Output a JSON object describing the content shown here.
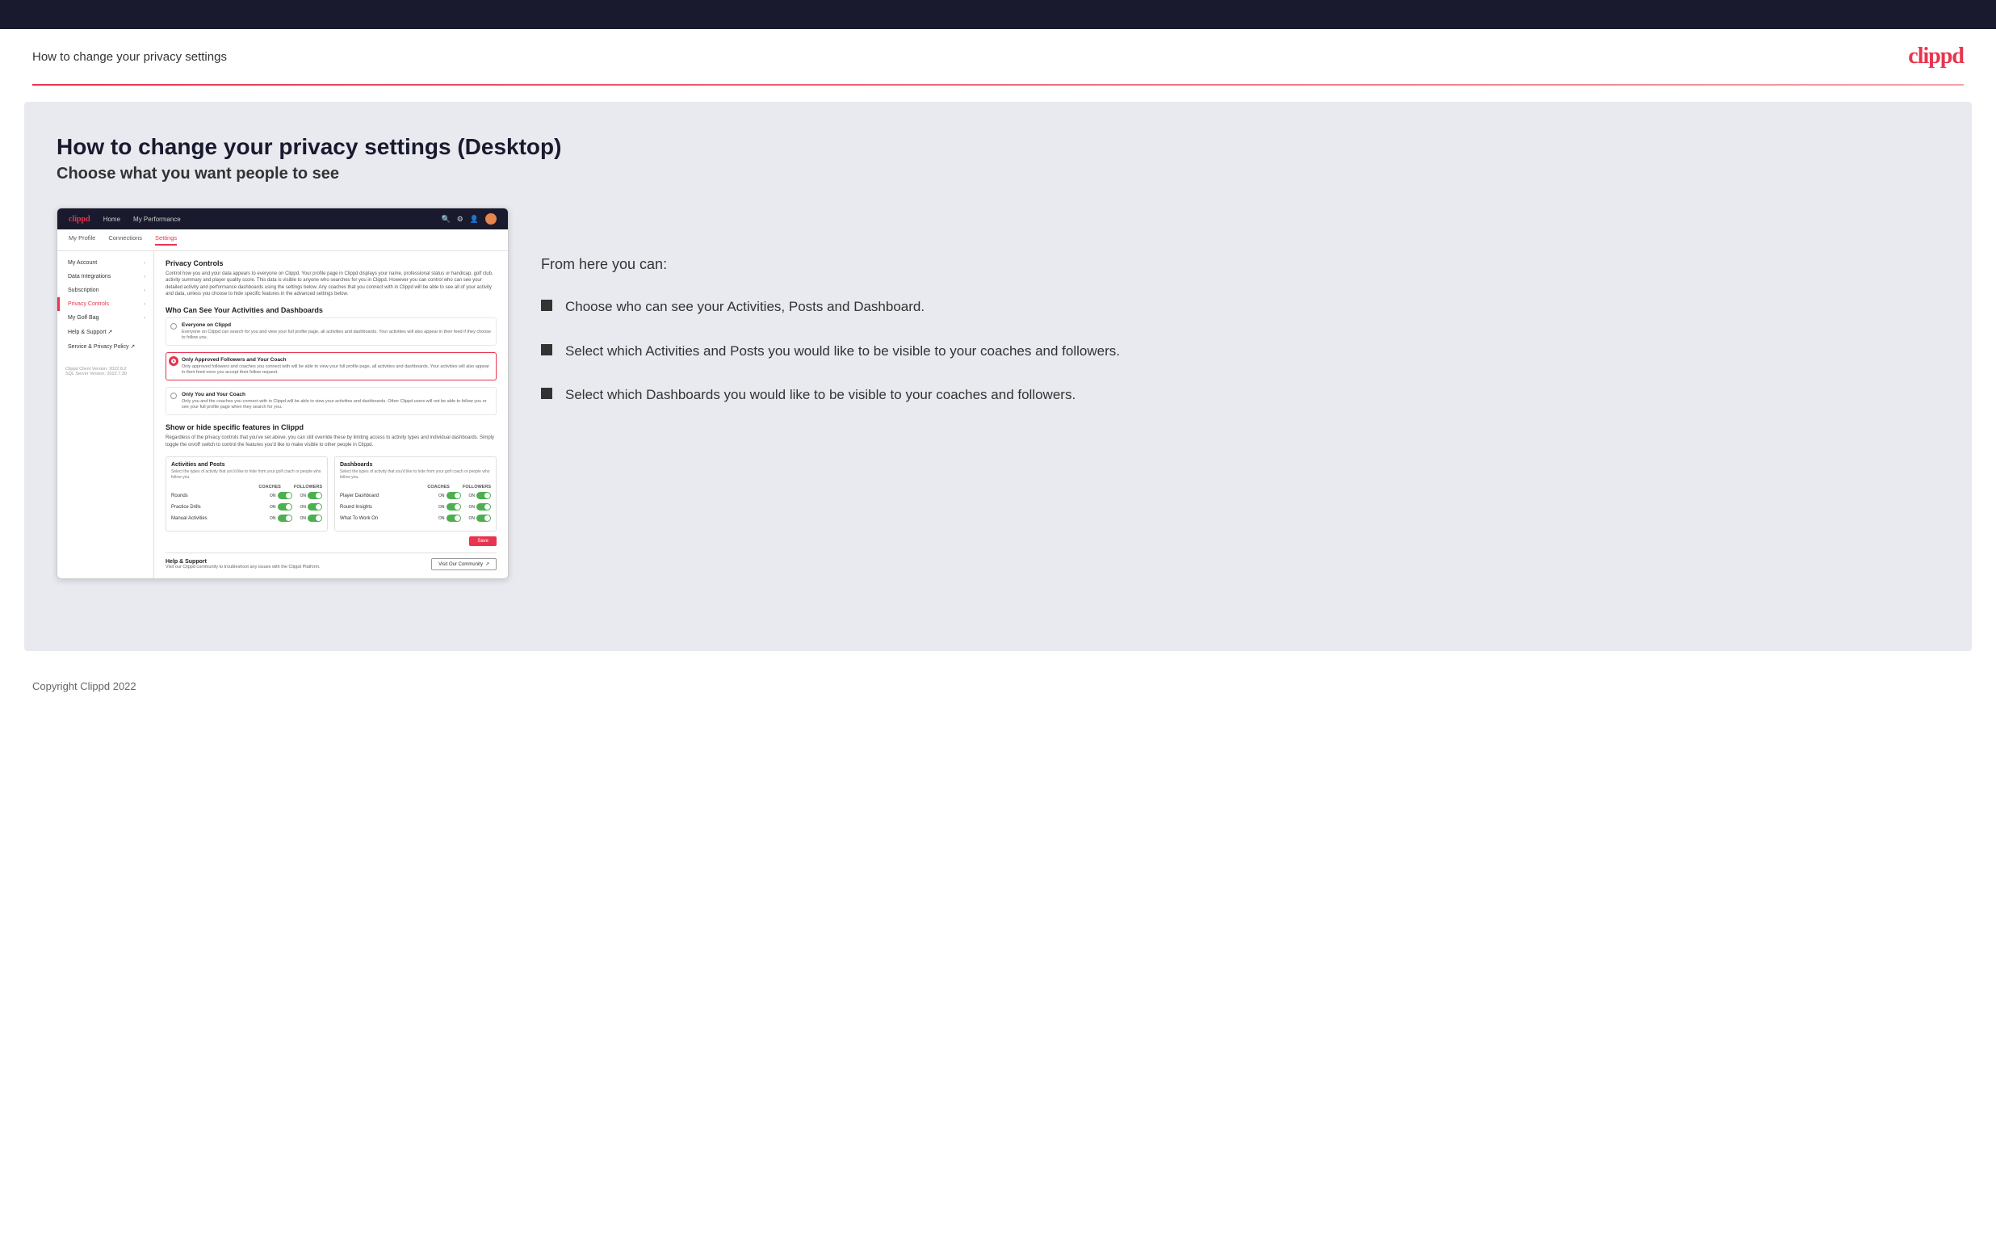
{
  "topbar": {},
  "header": {
    "title": "How to change your privacy settings",
    "logo": "clippd"
  },
  "main": {
    "heading": "How to change your privacy settings (Desktop)",
    "subheading": "Choose what you want people to see",
    "right_intro": "From here you can:",
    "bullets": [
      "Choose who can see your Activities, Posts and Dashboard.",
      "Select which Activities and Posts you would like to be visible to your coaches and followers.",
      "Select which Dashboards you would like to be visible to your coaches and followers."
    ]
  },
  "mockup": {
    "nav": {
      "logo": "clippd",
      "items": [
        "Home",
        "My Performance"
      ]
    },
    "subnav": [
      "My Profile",
      "Connections",
      "Settings"
    ],
    "sidebar": {
      "items": [
        {
          "label": "My Account",
          "active": false
        },
        {
          "label": "Data Integrations",
          "active": false
        },
        {
          "label": "Subscription",
          "active": false
        },
        {
          "label": "Privacy Controls",
          "active": true
        },
        {
          "label": "My Golf Bag",
          "active": false
        },
        {
          "label": "Help & Support",
          "active": false
        },
        {
          "label": "Service & Privacy Policy",
          "active": false
        }
      ],
      "version": "Clippd Client Version: 2022.8.2\nSQL Server Version: 2022.7.30"
    },
    "privacy": {
      "section_title": "Privacy Controls",
      "section_text": "Control how you and your data appears to everyone on Clippd. Your profile page in Clippd displays your name, professional status or handicap, golf club, activity summary and player quality score. This data is visible to anyone who searches for you in Clippd. However you can control who can see your detailed activity and performance dashboards using the settings below. Any coaches that you connect with in Clippd will be able to see all of your activity and data, unless you choose to hide specific features in the advanced settings below.",
      "who_can_see_title": "Who Can See Your Activities and Dashboards",
      "options": [
        {
          "label": "Everyone on Clippd",
          "desc": "Everyone on Clippd can search for you and view your full profile page, all activities and dashboards. Your activities will also appear in their feed if they choose to follow you.",
          "selected": false
        },
        {
          "label": "Only Approved Followers and Your Coach",
          "desc": "Only approved followers and coaches you connect with will be able to view your full profile page, all activities and dashboards. Your activities will also appear in their feed once you accept their follow request.",
          "selected": true
        },
        {
          "label": "Only You and Your Coach",
          "desc": "Only you and the coaches you connect with in Clippd will be able to view your activities and dashboards. Other Clippd users will not be able to follow you or see your full profile page when they search for you.",
          "selected": false
        }
      ],
      "show_hide_title": "Show or hide specific features in Clippd",
      "show_hide_text": "Regardless of the privacy controls that you've set above, you can still override these by limiting access to activity types and individual dashboards. Simply toggle the on/off switch to control the features you'd like to make visible to other people in Clippd.",
      "activities_title": "Activities and Posts",
      "activities_sub": "Select the types of activity that you'd like to hide from your golf coach or people who follow you.",
      "activities_rows": [
        "Rounds",
        "Practice Drills",
        "Manual Activities"
      ],
      "dashboards_title": "Dashboards",
      "dashboards_sub": "Select the types of activity that you'd like to hide from your golf coach or people who follow you.",
      "dashboards_rows": [
        "Player Dashboard",
        "Round Insights",
        "What To Work On"
      ],
      "coaches_label": "COACHES",
      "followers_label": "FOLLOWERS",
      "save_label": "Save",
      "help_title": "Help & Support",
      "help_sub": "Visit our Clippd community to troubleshoot any issues with the Clippd Platform.",
      "visit_label": "Visit Our Community"
    }
  },
  "footer": {
    "text": "Copyright Clippd 2022"
  }
}
